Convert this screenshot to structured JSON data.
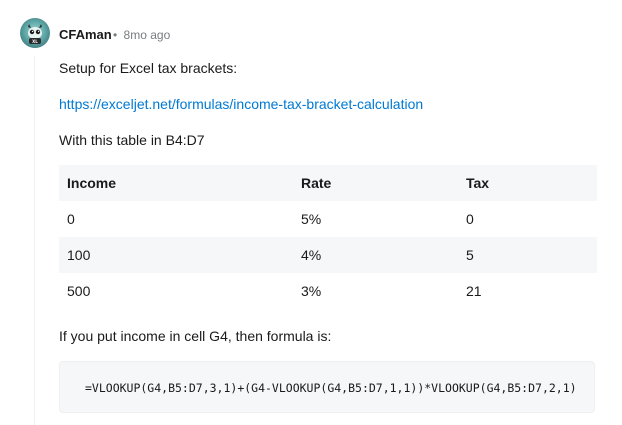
{
  "comment": {
    "author": "CFAman",
    "separator": "•",
    "age": "8mo ago",
    "paragraphs": {
      "intro": "Setup for Excel tax brackets:",
      "link": "https://exceljet.net/formulas/income-tax-bracket-calculation",
      "table_note": "With this table in B4:D7",
      "formula_note": "If you put income in cell G4, then formula is:"
    },
    "table": {
      "headers": [
        "Income",
        "Rate",
        "Tax"
      ],
      "rows": [
        [
          "0",
          "5%",
          "0"
        ],
        [
          "100",
          "4%",
          "5"
        ],
        [
          "500",
          "3%",
          "21"
        ]
      ]
    },
    "code": "=VLOOKUP(G4,B5:D7,3,1)+(G4-VLOOKUP(G4,B5:D7,1,1))*VLOOKUP(G4,B5:D7,2,1)"
  },
  "colors": {
    "link": "#0079d3",
    "meta": "#787c7e",
    "table_band": "#f6f7f8"
  }
}
